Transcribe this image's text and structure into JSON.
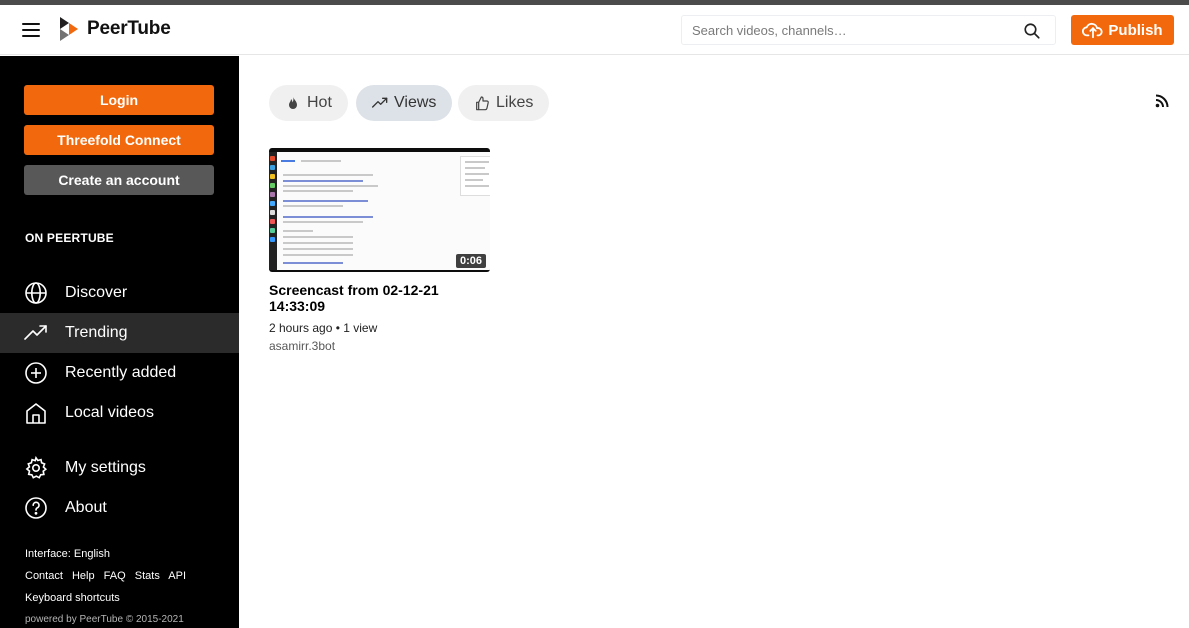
{
  "app": {
    "name": "PeerTube"
  },
  "search": {
    "placeholder": "Search videos, channels…"
  },
  "header": {
    "publish_label": "Publish"
  },
  "sidebar": {
    "login_label": "Login",
    "threefold_label": "Threefold Connect",
    "create_account_label": "Create an account",
    "section_title": "ON PEERTUBE",
    "items": [
      {
        "label": "Discover",
        "icon": "globe-icon"
      },
      {
        "label": "Trending",
        "icon": "trending-icon",
        "active": true
      },
      {
        "label": "Recently added",
        "icon": "plus-circle-icon"
      },
      {
        "label": "Local videos",
        "icon": "home-icon"
      },
      {
        "label": "My settings",
        "icon": "gear-icon"
      },
      {
        "label": "About",
        "icon": "help-icon"
      }
    ],
    "footer": {
      "interface_text": "Interface: English",
      "links": [
        "Contact",
        "Help",
        "FAQ",
        "Stats",
        "API"
      ],
      "shortcuts": "Keyboard shortcuts",
      "powered": "powered by PeerTube",
      "copyright": "© 2015-2021"
    }
  },
  "sort": {
    "tabs": [
      {
        "label": "Hot",
        "icon": "flame-icon"
      },
      {
        "label": "Views",
        "icon": "trending-icon",
        "active": true
      },
      {
        "label": "Likes",
        "icon": "thumbs-up-icon"
      }
    ]
  },
  "video": {
    "title": "Screencast from 02-12-21 14:33:09",
    "duration": "0:06",
    "meta": "2 hours ago • 1 view",
    "channel": "asamirr.3bot"
  },
  "colors": {
    "accent": "#f2690d",
    "sidebar_bg": "#000000",
    "active_item_bg": "#2b2b2b"
  }
}
